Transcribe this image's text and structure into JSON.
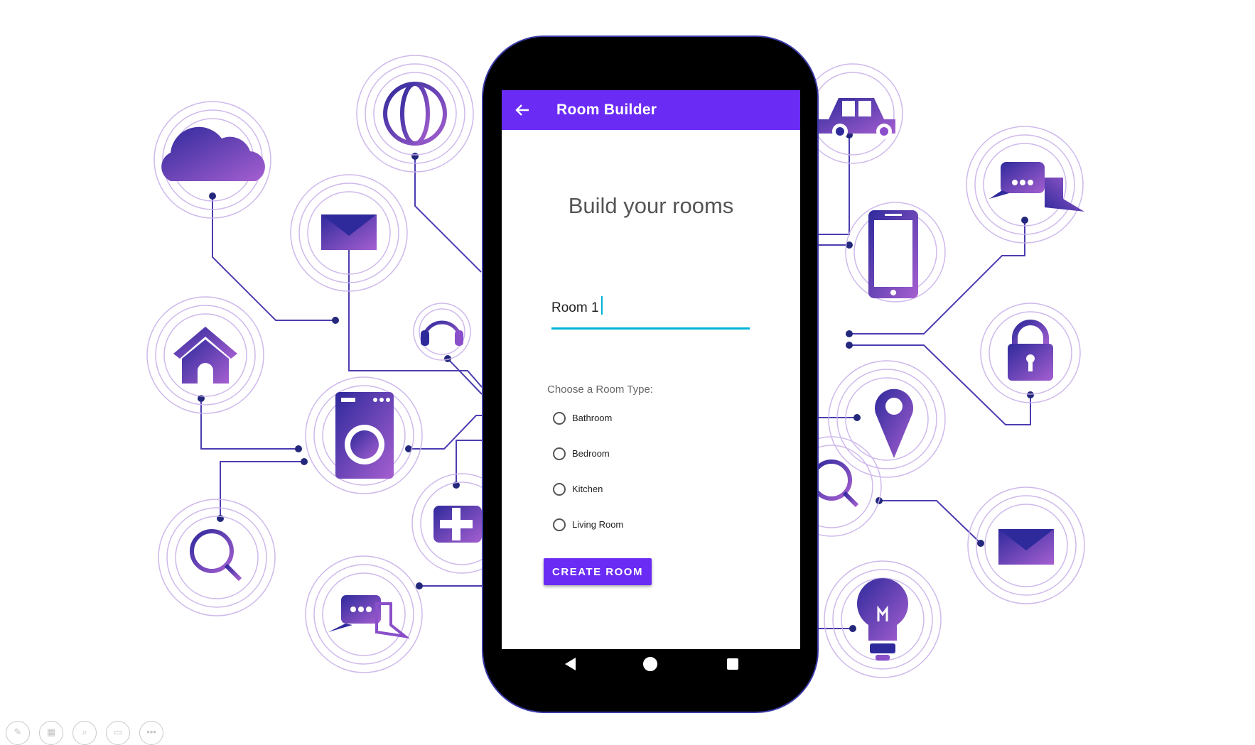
{
  "app": {
    "title": "Room Builder",
    "headline": "Build your rooms",
    "room_name_value": "Room 1",
    "room_type_label": "Choose a Room Type:",
    "room_types": [
      "Bathroom",
      "Bedroom",
      "Kitchen",
      "Living Room"
    ],
    "selected_room_type": null,
    "create_button_label": "CREATE ROOM"
  },
  "colors": {
    "app_bar": "#6a2cf5",
    "accent_underline": "#00b4d8",
    "icon_gradient_start": "#3a2ea3",
    "icon_gradient_end": "#9b5ad1",
    "circuit_line": "#4b3db0"
  },
  "background_icons": [
    "cloud-icon",
    "globe-icon",
    "envelope-icon",
    "headphones-icon",
    "home-icon",
    "washing-machine-icon",
    "search-icon",
    "medical-kit-icon",
    "chat-icon",
    "car-icon",
    "smartphone-icon",
    "chat-bubbles-icon",
    "padlock-icon",
    "map-pin-icon",
    "magnifier-icon",
    "envelope-icon-right",
    "lightbulb-icon"
  ],
  "navbar": [
    "back-triangle-icon",
    "home-circle-icon",
    "recents-square-icon"
  ],
  "toolbar": [
    "pencil-icon",
    "grid-icon",
    "zoom-icon",
    "slide-icon",
    "more-icon"
  ],
  "toolbar_glyphs": [
    "✎",
    "▦",
    "⌕",
    "▭",
    "•••"
  ]
}
